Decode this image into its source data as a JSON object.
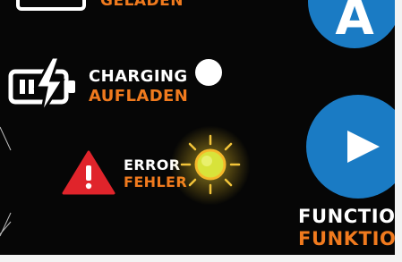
{
  "top_fragment": {
    "orange_label": "GELADEN"
  },
  "charging": {
    "label_en": "CHARGING",
    "label_de": "AUFLADEN"
  },
  "error": {
    "label_en": "ERROR",
    "label_de": "FEHLER"
  },
  "function": {
    "label_en": "FUNCTIO",
    "label_de": "FUNKTIO"
  },
  "buttons": {
    "top_letter": "A"
  },
  "icons": {
    "battery": "battery-charging-icon",
    "warning": "warning-triangle-icon",
    "indicator_off": "white-indicator-dot",
    "indicator_on": "yellow-glowing-indicator",
    "play": "play-icon"
  },
  "colors": {
    "background": "#060606",
    "accent_orange": "#f07a1e",
    "button_blue": "#1a7bc4",
    "warning_red": "#e0242b",
    "indicator_yellow": "#d8e33a"
  }
}
